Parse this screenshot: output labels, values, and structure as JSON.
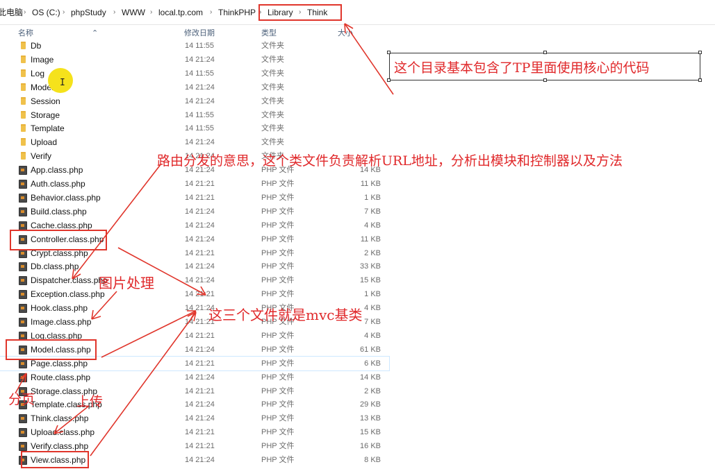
{
  "breadcrumb": [
    "此电脑",
    "OS (C:)",
    "phpStudy",
    "WWW",
    "local.tp.com",
    "ThinkPHP",
    "Library",
    "Think"
  ],
  "columns": {
    "name": "名称",
    "date": "修改日期",
    "type": "类型",
    "size": "大小"
  },
  "files": [
    {
      "name": "Db",
      "date": "14 11:55",
      "type": "文件夹",
      "size": "",
      "kind": "folder"
    },
    {
      "name": "Image",
      "date": "14 21:24",
      "type": "文件夹",
      "size": "",
      "kind": "folder"
    },
    {
      "name": "Log",
      "date": "14 11:55",
      "type": "文件夹",
      "size": "",
      "kind": "folder"
    },
    {
      "name": "Model",
      "date": "14 21:24",
      "type": "文件夹",
      "size": "",
      "kind": "folder"
    },
    {
      "name": "Session",
      "date": "14 21:24",
      "type": "文件夹",
      "size": "",
      "kind": "folder"
    },
    {
      "name": "Storage",
      "date": "14 11:55",
      "type": "文件夹",
      "size": "",
      "kind": "folder"
    },
    {
      "name": "Template",
      "date": "14 11:55",
      "type": "文件夹",
      "size": "",
      "kind": "folder"
    },
    {
      "name": "Upload",
      "date": "14 21:24",
      "type": "文件夹",
      "size": "",
      "kind": "folder"
    },
    {
      "name": "Verify",
      "date": "14 21:24",
      "type": "文件夹",
      "size": "",
      "kind": "folder"
    },
    {
      "name": "App.class.php",
      "date": "14 21:24",
      "type": "PHP 文件",
      "size": "14 KB",
      "kind": "php"
    },
    {
      "name": "Auth.class.php",
      "date": "14 21:21",
      "type": "PHP 文件",
      "size": "11 KB",
      "kind": "php"
    },
    {
      "name": "Behavior.class.php",
      "date": "14 21:21",
      "type": "PHP 文件",
      "size": "1 KB",
      "kind": "php"
    },
    {
      "name": "Build.class.php",
      "date": "14 21:24",
      "type": "PHP 文件",
      "size": "7 KB",
      "kind": "php"
    },
    {
      "name": "Cache.class.php",
      "date": "14 21:24",
      "type": "PHP 文件",
      "size": "4 KB",
      "kind": "php"
    },
    {
      "name": "Controller.class.php",
      "date": "14 21:24",
      "type": "PHP 文件",
      "size": "11 KB",
      "kind": "php"
    },
    {
      "name": "Crypt.class.php",
      "date": "14 21:21",
      "type": "PHP 文件",
      "size": "2 KB",
      "kind": "php"
    },
    {
      "name": "Db.class.php",
      "date": "14 21:24",
      "type": "PHP 文件",
      "size": "33 KB",
      "kind": "php"
    },
    {
      "name": "Dispatcher.class.php",
      "date": "14 21:24",
      "type": "PHP 文件",
      "size": "15 KB",
      "kind": "php"
    },
    {
      "name": "Exception.class.php",
      "date": "14 21:21",
      "type": "PHP 文件",
      "size": "1 KB",
      "kind": "php"
    },
    {
      "name": "Hook.class.php",
      "date": "14 21:24",
      "type": "PHP 文件",
      "size": "4 KB",
      "kind": "php"
    },
    {
      "name": "Image.class.php",
      "date": "14 21:21",
      "type": "PHP 文件",
      "size": "7 KB",
      "kind": "php"
    },
    {
      "name": "Log.class.php",
      "date": "14 21:21",
      "type": "PHP 文件",
      "size": "4 KB",
      "kind": "php"
    },
    {
      "name": "Model.class.php",
      "date": "14 21:24",
      "type": "PHP 文件",
      "size": "61 KB",
      "kind": "php"
    },
    {
      "name": "Page.class.php",
      "date": "14 21:21",
      "type": "PHP 文件",
      "size": "6 KB",
      "kind": "php"
    },
    {
      "name": "Route.class.php",
      "date": "14 21:24",
      "type": "PHP 文件",
      "size": "14 KB",
      "kind": "php"
    },
    {
      "name": "Storage.class.php",
      "date": "14 21:21",
      "type": "PHP 文件",
      "size": "2 KB",
      "kind": "php"
    },
    {
      "name": "Template.class.php",
      "date": "14 21:24",
      "type": "PHP 文件",
      "size": "29 KB",
      "kind": "php"
    },
    {
      "name": "Think.class.php",
      "date": "14 21:24",
      "type": "PHP 文件",
      "size": "13 KB",
      "kind": "php"
    },
    {
      "name": "Upload.class.php",
      "date": "14 21:21",
      "type": "PHP 文件",
      "size": "15 KB",
      "kind": "php"
    },
    {
      "name": "Verify.class.php",
      "date": "14 21:21",
      "type": "PHP 文件",
      "size": "16 KB",
      "kind": "php"
    },
    {
      "name": "View.class.php",
      "date": "14 21:24",
      "type": "PHP 文件",
      "size": "8 KB",
      "kind": "php"
    }
  ],
  "annotations": {
    "core_dir": "这个目录基本包含了TP里面使用核心的代码",
    "dispatcher": "路由分发的意思，这个类文件负责解析URL地址，分析出模块和控制器以及方法",
    "image": "图片处理",
    "mvc": "这三个文件就是mvc基类",
    "page": "分页",
    "upload": "上传"
  },
  "colors": {
    "annotation": "#e0352b",
    "folder": "#f0c14b",
    "header_text": "#4c607a"
  }
}
